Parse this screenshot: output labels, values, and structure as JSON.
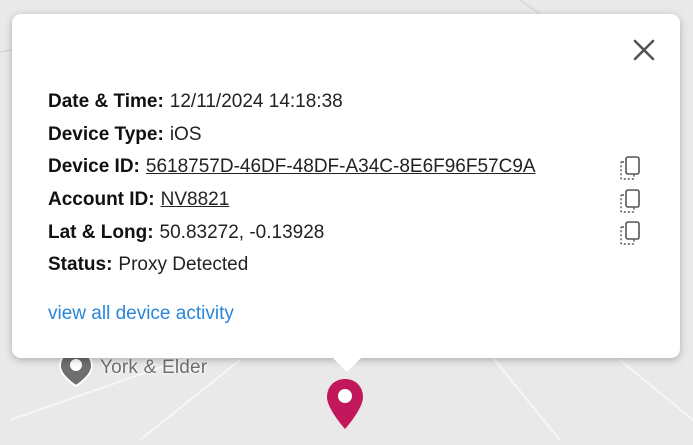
{
  "map": {
    "poi_label": "York & Elder",
    "marker_color": "#c2185b"
  },
  "popup": {
    "close_icon": "close-icon",
    "rows": [
      {
        "label": "Date & Time:",
        "value": "12/11/2024 14:18:38"
      },
      {
        "label": "Device Type:",
        "value": "iOS"
      },
      {
        "label": "Device ID:",
        "value": "5618757D-46DF-48DF-A34C-8E6F96F57C9A",
        "copy_icon": "copy-icon"
      },
      {
        "label": "Account ID:",
        "value": "NV8821",
        "copy_icon": "copy-icon"
      },
      {
        "label": "Lat & Long:",
        "value": "50.83272, -0.13928",
        "copy_icon": "copy-icon"
      },
      {
        "label": "Status:",
        "value": "Proxy Detected"
      }
    ],
    "activity_link": "view all device activity",
    "link_color": "#2a86d8"
  }
}
